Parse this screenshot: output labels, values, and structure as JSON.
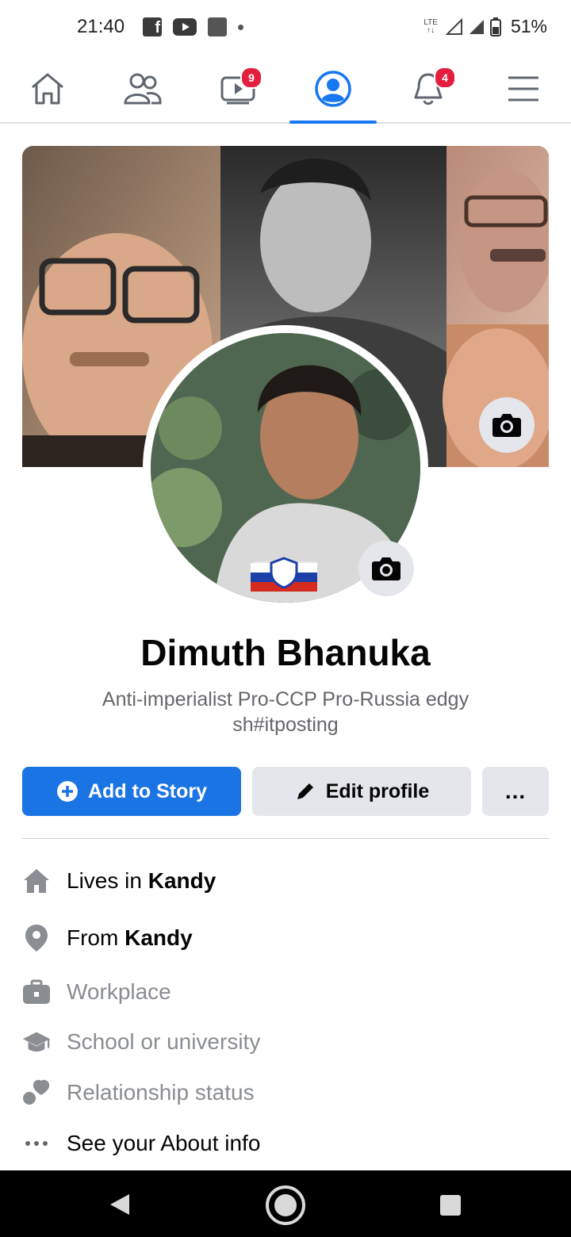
{
  "status_bar": {
    "time": "21:40",
    "network": "LTE",
    "battery": "51%"
  },
  "nav": {
    "tabs": [
      {
        "name": "home",
        "icon": "home-icon"
      },
      {
        "name": "friends",
        "icon": "friends-icon"
      },
      {
        "name": "watch",
        "icon": "video-icon",
        "badge": "9"
      },
      {
        "name": "profile",
        "icon": "profile-icon",
        "active": true
      },
      {
        "name": "notifications",
        "icon": "bell-icon",
        "badge": "4"
      },
      {
        "name": "menu",
        "icon": "hamburger-icon"
      }
    ]
  },
  "profile": {
    "name": "Dimuth Bhanuka",
    "bio": "Anti-imperialist Pro-CCP Pro-Russia edgy sh#itposting"
  },
  "actions": {
    "add_story": "Add to Story",
    "edit_profile": "Edit profile",
    "more": "..."
  },
  "details": {
    "lives_prefix": "Lives in ",
    "lives_city": "Kandy",
    "from_prefix": "From ",
    "from_city": "Kandy",
    "workplace": "Workplace",
    "school": "School or university",
    "relationship": "Relationship status",
    "about": "See your About info"
  },
  "colors": {
    "accent": "#1877f2",
    "badge": "#e41e3f",
    "button_primary": "#1b74e4",
    "button_secondary": "#e4e6eb",
    "muted_text": "#65676b"
  }
}
